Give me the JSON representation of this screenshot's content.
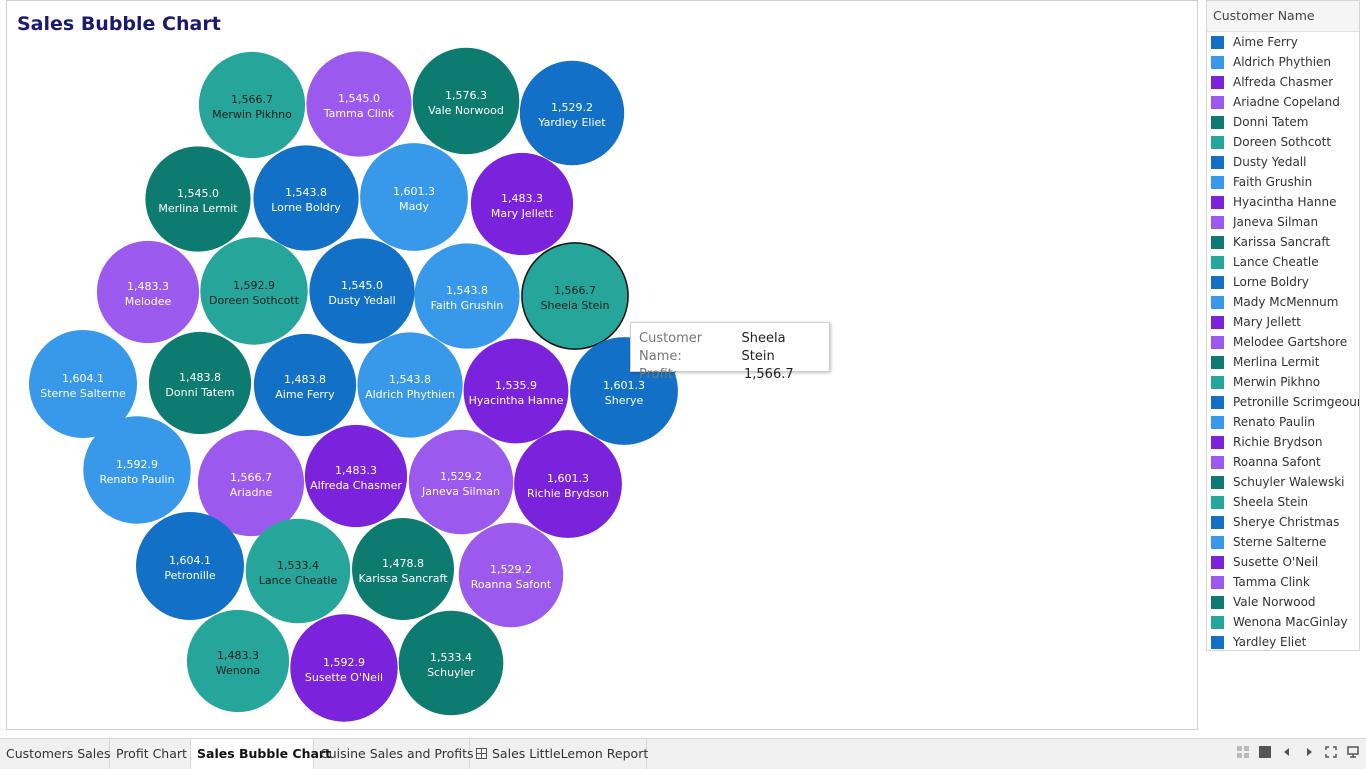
{
  "title": "Sales Bubble Chart",
  "chart_data": {
    "type": "bubble",
    "measure": "Profit",
    "dimension": "Customer Name",
    "points": [
      {
        "label": "Merwin Pikhno",
        "value": 1566.7,
        "value_text": "1,566.7",
        "color": "#26a69a"
      },
      {
        "label": "Tamma Clink",
        "value": 1545.0,
        "value_text": "1,545.0",
        "color": "#9c59ed"
      },
      {
        "label": "Vale Norwood",
        "value": 1576.3,
        "value_text": "1,576.3",
        "color": "#0e7b70"
      },
      {
        "label": "Yardley Eliet",
        "value": 1529.2,
        "value_text": "1,529.2",
        "color": "#1271c6"
      },
      {
        "label": "Merlina Lermit",
        "value": 1545.0,
        "value_text": "1,545.0",
        "color": "#0e7b70"
      },
      {
        "label": "Lorne Boldry",
        "value": 1543.8,
        "value_text": "1,543.8",
        "color": "#1271c6"
      },
      {
        "label": "Mady",
        "value": 1601.3,
        "value_text": "1,601.3",
        "color": "#3898ea"
      },
      {
        "label": "Mary Jellett",
        "value": 1483.3,
        "value_text": "1,483.3",
        "color": "#7a22dc"
      },
      {
        "label": "Melodee",
        "value": 1483.3,
        "value_text": "1,483.3",
        "color": "#9c59ed"
      },
      {
        "label": "Doreen Sothcott",
        "value": 1592.9,
        "value_text": "1,592.9",
        "color": "#26a69a"
      },
      {
        "label": "Dusty Yedall",
        "value": 1545.0,
        "value_text": "1,545.0",
        "color": "#1271c6"
      },
      {
        "label": "Faith Grushin",
        "value": 1543.8,
        "value_text": "1,543.8",
        "color": "#3898ea"
      },
      {
        "label": "Sheela Stein",
        "value": 1566.7,
        "value_text": "1,566.7",
        "color": "#26a69a"
      },
      {
        "label": "Sterne Salterne",
        "value": 1604.1,
        "value_text": "1,604.1",
        "color": "#3898ea"
      },
      {
        "label": "Donni Tatem",
        "value": 1483.8,
        "value_text": "1,483.8",
        "color": "#0e7b70"
      },
      {
        "label": "Aime Ferry",
        "value": 1483.8,
        "value_text": "1,483.8",
        "color": "#1271c6"
      },
      {
        "label": "Aldrich Phythien",
        "value": 1543.8,
        "value_text": "1,543.8",
        "color": "#3898ea"
      },
      {
        "label": "Hyacintha Hanne",
        "value": 1535.9,
        "value_text": "1,535.9",
        "color": "#7a22dc"
      },
      {
        "label": "Sherye",
        "value": 1601.3,
        "value_text": "1,601.3",
        "color": "#1271c6"
      },
      {
        "label": "Renato Paulin",
        "value": 1592.9,
        "value_text": "1,592.9",
        "color": "#3898ea"
      },
      {
        "label": "Ariadne",
        "value": 1566.7,
        "value_text": "1,566.7",
        "color": "#9c59ed"
      },
      {
        "label": "Alfreda Chasmer",
        "value": 1483.3,
        "value_text": "1,483.3",
        "color": "#7a22dc"
      },
      {
        "label": "Janeva Silman",
        "value": 1529.2,
        "value_text": "1,529.2",
        "color": "#9c59ed"
      },
      {
        "label": "Richie Brydson",
        "value": 1601.3,
        "value_text": "1,601.3",
        "color": "#7a22dc"
      },
      {
        "label": "Petronille",
        "value": 1604.1,
        "value_text": "1,604.1",
        "color": "#1271c6"
      },
      {
        "label": "Lance Cheatle",
        "value": 1533.4,
        "value_text": "1,533.4",
        "color": "#26a69a"
      },
      {
        "label": "Karissa Sancraft",
        "value": 1478.8,
        "value_text": "1,478.8",
        "color": "#0e7b70"
      },
      {
        "label": "Roanna Safont",
        "value": 1529.2,
        "value_text": "1,529.2",
        "color": "#9c59ed"
      },
      {
        "label": "Wenona",
        "value": 1483.3,
        "value_text": "1,483.3",
        "color": "#26a69a"
      },
      {
        "label": "Susette O'Neil",
        "value": 1592.9,
        "value_text": "1,592.9",
        "color": "#7a22dc"
      },
      {
        "label": "Schuyler",
        "value": 1533.4,
        "value_text": "1,533.4",
        "color": "#0e7b70"
      }
    ]
  },
  "tooltip": {
    "name_key": "Customer Name:",
    "name_value": "Sheela Stein",
    "profit_key": "Profit:",
    "profit_value": "1,566.7"
  },
  "legend": {
    "title": "Customer Name",
    "items": [
      {
        "label": "Aime Ferry",
        "color": "#1271c6"
      },
      {
        "label": "Aldrich Phythien",
        "color": "#3898ea"
      },
      {
        "label": "Alfreda Chasmer",
        "color": "#7a22dc"
      },
      {
        "label": "Ariadne Copeland",
        "color": "#9c59ed"
      },
      {
        "label": "Donni Tatem",
        "color": "#0e7b70"
      },
      {
        "label": "Doreen Sothcott",
        "color": "#26a69a"
      },
      {
        "label": "Dusty Yedall",
        "color": "#1271c6"
      },
      {
        "label": "Faith Grushin",
        "color": "#3898ea"
      },
      {
        "label": "Hyacintha Hanne",
        "color": "#7a22dc"
      },
      {
        "label": "Janeva Silman",
        "color": "#9c59ed"
      },
      {
        "label": "Karissa Sancraft",
        "color": "#0e7b70"
      },
      {
        "label": "Lance Cheatle",
        "color": "#26a69a"
      },
      {
        "label": "Lorne Boldry",
        "color": "#1271c6"
      },
      {
        "label": "Mady McMennum",
        "color": "#3898ea"
      },
      {
        "label": "Mary Jellett",
        "color": "#7a22dc"
      },
      {
        "label": "Melodee Gartshore",
        "color": "#9c59ed"
      },
      {
        "label": "Merlina Lermit",
        "color": "#0e7b70"
      },
      {
        "label": "Merwin Pikhno",
        "color": "#26a69a"
      },
      {
        "label": "Petronille Scrimgeour",
        "color": "#1271c6"
      },
      {
        "label": "Renato Paulin",
        "color": "#3898ea"
      },
      {
        "label": "Richie Brydson",
        "color": "#7a22dc"
      },
      {
        "label": "Roanna Safont",
        "color": "#9c59ed"
      },
      {
        "label": "Schuyler Walewski",
        "color": "#0e7b70"
      },
      {
        "label": "Sheela Stein",
        "color": "#26a69a"
      },
      {
        "label": "Sherye Christmas",
        "color": "#1271c6"
      },
      {
        "label": "Sterne Salterne",
        "color": "#3898ea"
      },
      {
        "label": "Susette O'Neil",
        "color": "#7a22dc"
      },
      {
        "label": "Tamma Clink",
        "color": "#9c59ed"
      },
      {
        "label": "Vale Norwood",
        "color": "#0e7b70"
      },
      {
        "label": "Wenona MacGinlay",
        "color": "#26a69a"
      },
      {
        "label": "Yardley Eliet",
        "color": "#1271c6"
      }
    ]
  },
  "tabs": [
    {
      "label": "Customers Sales",
      "active": false
    },
    {
      "label": "Profit Chart",
      "active": false
    },
    {
      "label": "Sales Bubble Chart",
      "active": true
    },
    {
      "label": "Cuisine Sales and Profits",
      "active": false
    },
    {
      "label": "Sales LittleLemon Report",
      "active": false
    }
  ],
  "nav_icons": [
    "grid-view-icon",
    "fill-icon",
    "previous-icon",
    "next-icon",
    "fullscreen-icon",
    "presentation-icon"
  ]
}
